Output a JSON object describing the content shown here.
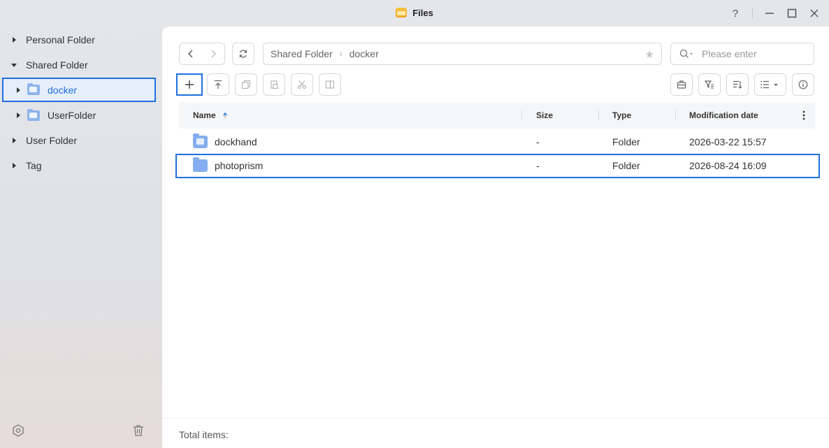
{
  "window": {
    "title": "Files",
    "controls": [
      "help-icon",
      "minimize-icon",
      "maximize-icon",
      "close-icon"
    ]
  },
  "sidebar": {
    "items": [
      {
        "label": "Personal Folder",
        "expanded": false
      },
      {
        "label": "Shared Folder",
        "expanded": true
      },
      {
        "label": "docker",
        "selected": true,
        "child": true
      },
      {
        "label": "UserFolder",
        "child": true
      },
      {
        "label": "User Folder",
        "expanded": false
      },
      {
        "label": "Tag",
        "expanded": false
      }
    ],
    "footer_icons": [
      "settings-icon",
      "trash-icon"
    ]
  },
  "toolbar": {
    "path": [
      "Shared Folder",
      "docker"
    ],
    "search_placeholder": "Please enter"
  },
  "table": {
    "columns": [
      "Name",
      "Size",
      "Type",
      "Modification date"
    ],
    "rows": [
      {
        "name": "dockhand",
        "size": "-",
        "type": "Folder",
        "modified": "2026-03-22 15:57"
      },
      {
        "name": "photoprism",
        "size": "-",
        "type": "Folder",
        "modified": "2026-08-24 16:09",
        "selected": true
      }
    ]
  },
  "footer": {
    "total_label": "Total items:",
    "total_value": ""
  },
  "colors": {
    "accent": "#1f6fe0",
    "folder": "#84aef0"
  }
}
